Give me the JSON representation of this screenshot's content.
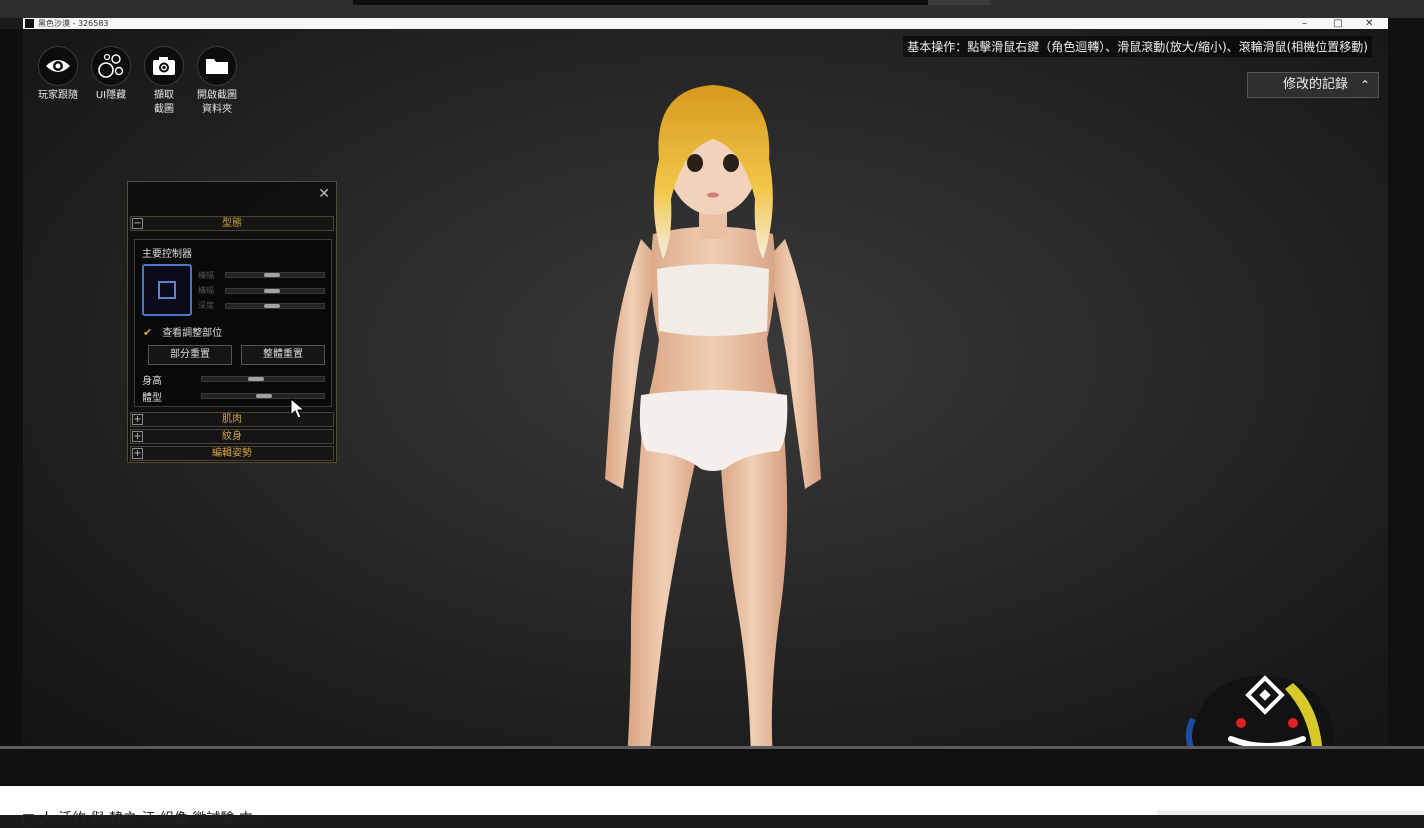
{
  "window": {
    "title": "黑色沙漠 - 326583",
    "buttons": [
      "–",
      "□",
      "✕"
    ]
  },
  "toolbar": [
    {
      "name": "player-follow",
      "icon": "eye-icon",
      "label": "玩家跟隨"
    },
    {
      "name": "ui-hide",
      "icon": "bubbles-icon",
      "label": "UI隱藏"
    },
    {
      "name": "screenshot",
      "icon": "camera-icon",
      "label": "擷取\n截圖"
    },
    {
      "name": "open-screenshot-folder",
      "icon": "folder-icon",
      "label": "開啟截圖\n資料夾"
    }
  ],
  "hint": "基本操作：點擊滑鼠右鍵（角色迴轉）、滑鼠滾動(放大/縮小)、滾輪滑鼠(相機位置移動)",
  "history": {
    "label": "修改的記錄",
    "icon": "chevron-up-icon"
  },
  "panel": {
    "close": "✕",
    "sections": {
      "shape": {
        "label": "型態",
        "toggle": "−"
      },
      "muscle": {
        "label": "肌肉",
        "toggle": "+"
      },
      "tattoo": {
        "label": "紋身",
        "toggle": "+"
      },
      "pose": {
        "label": "編輯姿勢",
        "toggle": "+"
      }
    },
    "main_controller": "主要控制器",
    "axes": [
      {
        "label": "橫幅",
        "value": 0.5
      },
      {
        "label": "橫幅",
        "value": 0.5
      },
      {
        "label": "深度",
        "value": 0.5
      }
    ],
    "view_adjust": {
      "label": "查看調整部位",
      "checked": "✔"
    },
    "partial_reset": "部分重置",
    "full_reset": "整體重置",
    "height": {
      "label": "身高",
      "value": 0.45
    },
    "body_type": {
      "label": "體型",
      "value": 0.6
    }
  },
  "caption": "□ 人 活約 與 韓之 江 組像 微試驗 中 。"
}
